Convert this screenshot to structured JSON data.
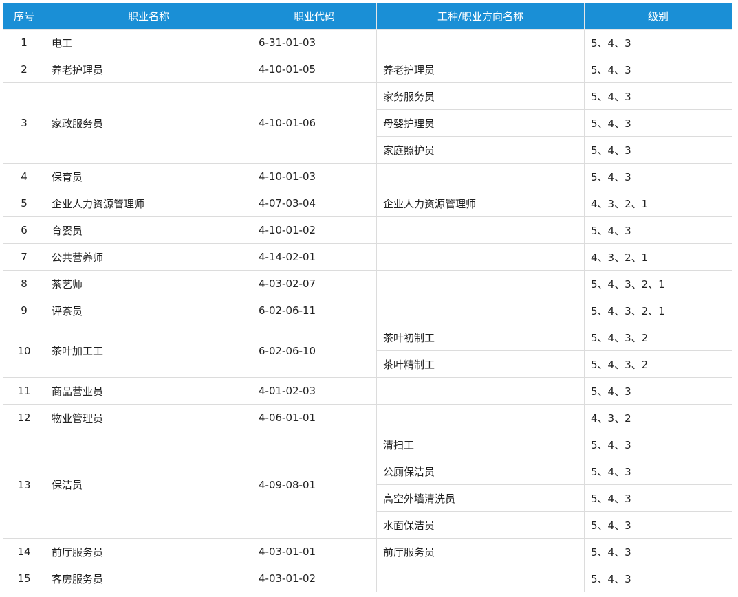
{
  "headers": {
    "seq": "序号",
    "name": "职业名称",
    "code": "职业代码",
    "direction": "工种/职业方向名称",
    "level": "级别"
  },
  "occupations": [
    {
      "seq": "1",
      "name": "电工",
      "code": "6-31-01-03",
      "directions": [
        {
          "name": "",
          "level": "5、4、3"
        }
      ]
    },
    {
      "seq": "2",
      "name": "养老护理员",
      "code": "4-10-01-05",
      "directions": [
        {
          "name": "养老护理员",
          "level": "5、4、3"
        }
      ]
    },
    {
      "seq": "3",
      "name": "家政服务员",
      "code": "4-10-01-06",
      "directions": [
        {
          "name": "家务服务员",
          "level": "5、4、3"
        },
        {
          "name": "母婴护理员",
          "level": "5、4、3"
        },
        {
          "name": "家庭照护员",
          "level": "5、4、3"
        }
      ]
    },
    {
      "seq": "4",
      "name": "保育员",
      "code": "4-10-01-03",
      "directions": [
        {
          "name": "",
          "level": "5、4、3"
        }
      ]
    },
    {
      "seq": "5",
      "name": "企业人力资源管理师",
      "code": "4-07-03-04",
      "directions": [
        {
          "name": "企业人力资源管理师",
          "level": "4、3、2、1"
        }
      ]
    },
    {
      "seq": "6",
      "name": "育婴员",
      "code": "4-10-01-02",
      "directions": [
        {
          "name": "",
          "level": "5、4、3"
        }
      ]
    },
    {
      "seq": "7",
      "name": "公共营养师",
      "code": "4-14-02-01",
      "directions": [
        {
          "name": "",
          "level": "4、3、2、1"
        }
      ]
    },
    {
      "seq": "8",
      "name": "茶艺师",
      "code": "4-03-02-07",
      "directions": [
        {
          "name": "",
          "level": "5、4、3、2、1"
        }
      ]
    },
    {
      "seq": "9",
      "name": "评茶员",
      "code": "6-02-06-11",
      "directions": [
        {
          "name": "",
          "level": "5、4、3、2、1"
        }
      ]
    },
    {
      "seq": "10",
      "name": "茶叶加工工",
      "code": "6-02-06-10",
      "directions": [
        {
          "name": "茶叶初制工",
          "level": "5、4、3、2"
        },
        {
          "name": "茶叶精制工",
          "level": "5、4、3、2"
        }
      ]
    },
    {
      "seq": "11",
      "name": "商品营业员",
      "code": "4-01-02-03",
      "directions": [
        {
          "name": "",
          "level": "5、4、3"
        }
      ]
    },
    {
      "seq": "12",
      "name": "物业管理员",
      "code": "4-06-01-01",
      "directions": [
        {
          "name": "",
          "level": "4、3、2"
        }
      ]
    },
    {
      "seq": "13",
      "name": "保洁员",
      "code": "4-09-08-01",
      "directions": [
        {
          "name": "清扫工",
          "level": "5、4、3"
        },
        {
          "name": "公厕保洁员",
          "level": "5、4、3"
        },
        {
          "name": "高空外墙清洗员",
          "level": "5、4、3"
        },
        {
          "name": "水面保洁员",
          "level": "5、4、3"
        }
      ]
    },
    {
      "seq": "14",
      "name": "前厅服务员",
      "code": "4-03-01-01",
      "directions": [
        {
          "name": "前厅服务员",
          "level": "5、4、3"
        }
      ]
    },
    {
      "seq": "15",
      "name": "客房服务员",
      "code": "4-03-01-02",
      "directions": [
        {
          "name": "",
          "level": "5、4、3"
        }
      ]
    }
  ]
}
